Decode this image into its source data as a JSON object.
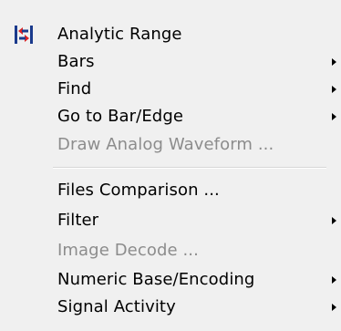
{
  "menu": {
    "items": [
      {
        "label": "Analytic Range",
        "icon": "analytic-range-icon"
      },
      {
        "label": "Bars",
        "submenu": true
      },
      {
        "label": "Find",
        "submenu": true
      },
      {
        "label": "Go to Bar/Edge",
        "submenu": true
      },
      {
        "label": "Draw Analog Waveform ...",
        "disabled": true
      },
      {
        "label": "Files Comparison ..."
      },
      {
        "label": "Filter",
        "submenu": true
      },
      {
        "label": "Image Decode ...",
        "disabled": true
      },
      {
        "label": "Numeric Base/Encoding",
        "submenu": true
      },
      {
        "label": "Signal Activity",
        "submenu": true
      }
    ]
  }
}
